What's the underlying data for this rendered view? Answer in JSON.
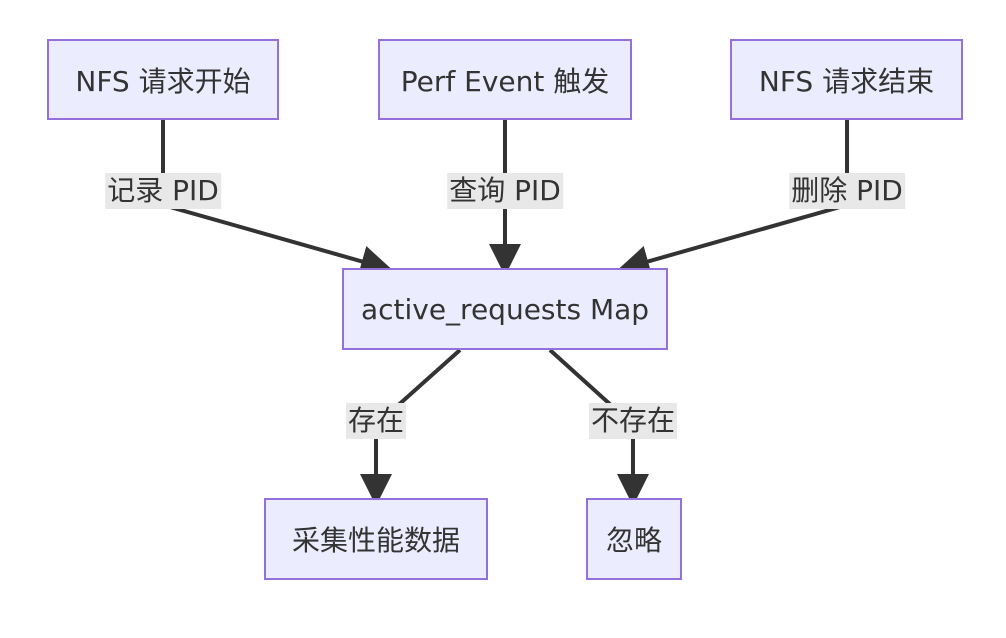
{
  "diagram": {
    "type": "flowchart",
    "nodes": {
      "nfs_start": "NFS 请求开始",
      "perf_event": "Perf Event 触发",
      "nfs_end": "NFS 请求结束",
      "active_map": "active_requests Map",
      "collect": "采集性能数据",
      "ignore": "忽略"
    },
    "edges": [
      {
        "from": "nfs_start",
        "to": "active_map",
        "label": "记录 PID"
      },
      {
        "from": "perf_event",
        "to": "active_map",
        "label": "查询 PID"
      },
      {
        "from": "nfs_end",
        "to": "active_map",
        "label": "删除 PID"
      },
      {
        "from": "active_map",
        "to": "collect",
        "label": "存在"
      },
      {
        "from": "active_map",
        "to": "ignore",
        "label": "不存在"
      }
    ],
    "colors": {
      "node_fill": "#ececff",
      "node_border": "#9370db",
      "edge": "#333333",
      "label_bg": "#e8e8e8"
    }
  }
}
